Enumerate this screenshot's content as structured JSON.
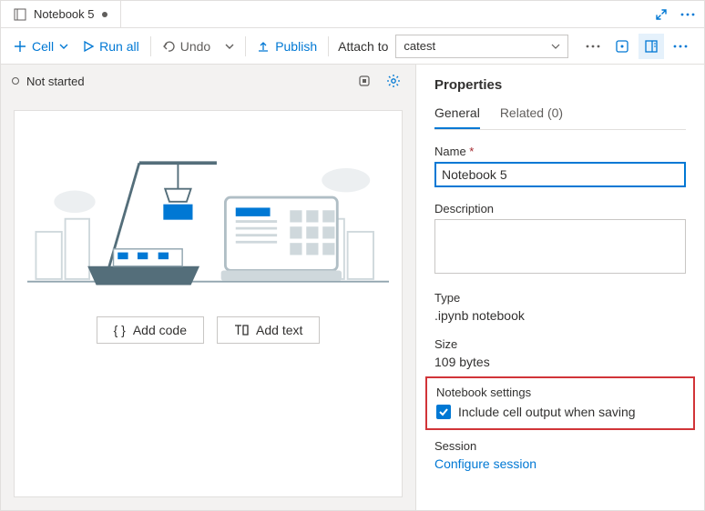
{
  "tab": {
    "title": "Notebook 5",
    "modified": true
  },
  "toolbar": {
    "cell": "Cell",
    "runall": "Run all",
    "undo": "Undo",
    "publish": "Publish",
    "attach_label": "Attach to",
    "attach_value": "catest"
  },
  "status": {
    "text": "Not started"
  },
  "hero": {
    "add_code": "Add code",
    "add_text": "Add text"
  },
  "props": {
    "title": "Properties",
    "tab_general": "General",
    "tab_related": "Related (0)",
    "name_label": "Name",
    "name_value": "Notebook 5",
    "desc_label": "Description",
    "desc_value": "",
    "type_label": "Type",
    "type_value": ".ipynb notebook",
    "size_label": "Size",
    "size_value": "109 bytes",
    "settings_label": "Notebook settings",
    "settings_checkbox": "Include cell output when saving",
    "session_label": "Session",
    "session_link": "Configure session"
  }
}
